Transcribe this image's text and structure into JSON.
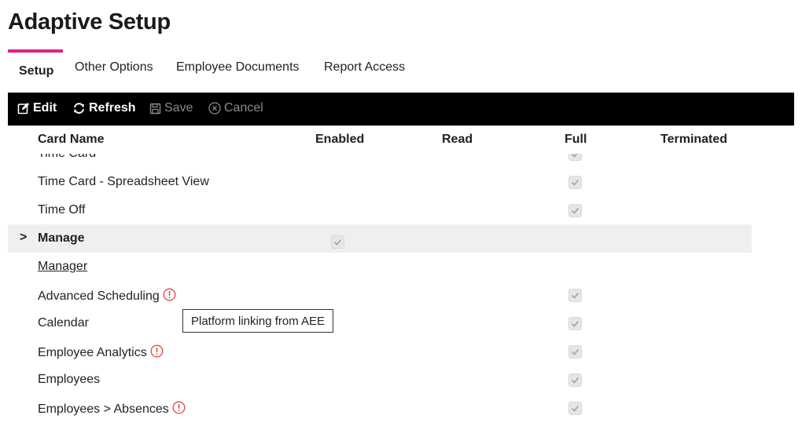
{
  "title": "Adaptive Setup",
  "tabs": [
    {
      "label": "Setup",
      "active": true
    },
    {
      "label": "Other Options",
      "active": false
    },
    {
      "label": "Employee Documents",
      "active": false
    },
    {
      "label": "Report Access",
      "active": false
    }
  ],
  "toolbar": {
    "edit": "Edit",
    "refresh": "Refresh",
    "save": "Save",
    "cancel": "Cancel"
  },
  "grid": {
    "columns": [
      "Card Name",
      "Enabled",
      "Read",
      "Full",
      "Terminated"
    ],
    "rows": [
      {
        "name": "Time Card",
        "full": true
      },
      {
        "name": "Time Card - Spreadsheet View",
        "full": true
      },
      {
        "name": "Time Off",
        "full": true
      },
      {
        "name": "Manage",
        "group": true,
        "enabled": true
      },
      {
        "name": "Manager",
        "link": true
      },
      {
        "name": "Advanced Scheduling",
        "warning": true,
        "full": true
      },
      {
        "name": "Calendar",
        "full": true
      },
      {
        "name": "Employee Analytics",
        "warning": true,
        "full": true
      },
      {
        "name": "Employees",
        "full": true
      },
      {
        "name": "Employees > Absences",
        "warning": true,
        "full": true
      }
    ]
  },
  "tooltip": "Platform linking from AEE",
  "colors": {
    "accent": "#e0218a",
    "toolbar_bg": "#000000",
    "warning": "#e0483e",
    "group_row_bg": "#efeff1"
  },
  "icons": {
    "edit": "edit-icon",
    "refresh": "refresh-icon",
    "save": "save-icon",
    "cancel": "cancel-icon",
    "warning": "warning-icon",
    "expand": "chevron-right-icon",
    "check": "checkbox-checked-icon"
  }
}
